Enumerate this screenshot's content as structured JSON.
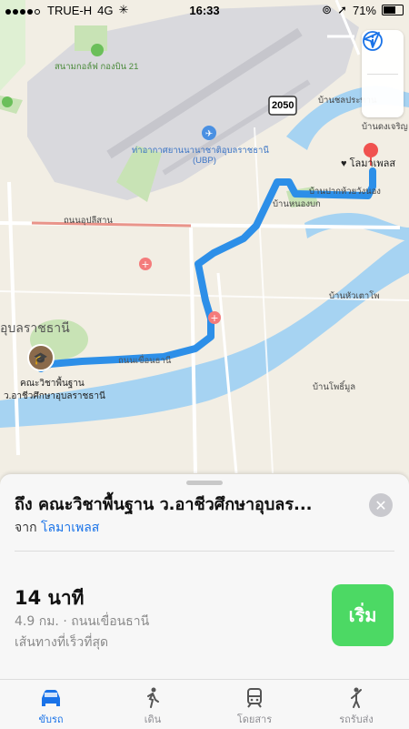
{
  "status_bar": {
    "carrier": "TRUE-H",
    "network": "4G",
    "time": "16:33",
    "battery": "71%",
    "battery_level": 0.71
  },
  "map": {
    "labels": {
      "golf": "สนามกอล์ฟ กองบิน 21",
      "airport_th": "ท่าอากาศยานนานาชาติอุบลราชธานี",
      "airport_code": "(UBP)",
      "highway": "2050",
      "ban_chonprathan": "บ้านชลประทาน",
      "ban_dongcharoen": "บ้านดงเจริญ",
      "lomapalace": "โลมาเพลส",
      "ban_pakhuai": "บ้านปากห้วยวังนอง",
      "ban_nongbok": "บ้านหนองบก",
      "road_upparisan": "ถนนอุปลีสาน",
      "ban_huataopo": "บ้านหัวเตาโพ",
      "city": "อุบลราชธานี",
      "road_khuean": "ถนนเขื่อนธานี",
      "ban_phonmun": "บ้านโพธิ์มูล",
      "dest_line1": "คณะวิชาพื้นฐาน",
      "dest_line2": "ว.อาชีวศึกษาอุบลราชธานี"
    }
  },
  "sheet": {
    "title": "ถึง คณะวิชาพื้นฐาน ว.อาชีวศึกษาอุบลร...",
    "from_prefix": "จาก",
    "from_place": "โลมาเพลส",
    "close_symbol": "✕",
    "eta": "14 นาที",
    "distance": "4.9 กม. · ถนนเขื่อนธานี",
    "route_note": "เส้นทางที่เร็วที่สุด",
    "go_label": "เริ่ม"
  },
  "tabs": [
    {
      "label": "ขับรถ",
      "icon": "car-icon",
      "active": true
    },
    {
      "label": "เดิน",
      "icon": "walk-icon",
      "active": false
    },
    {
      "label": "โดยสาร",
      "icon": "train-icon",
      "active": false
    },
    {
      "label": "รถรับส่ง",
      "icon": "rideshare-icon",
      "active": false
    }
  ],
  "colors": {
    "route": "#2d8fe8",
    "river": "#a6d3f2",
    "go": "#4cd964",
    "accent": "#1a73e8"
  }
}
